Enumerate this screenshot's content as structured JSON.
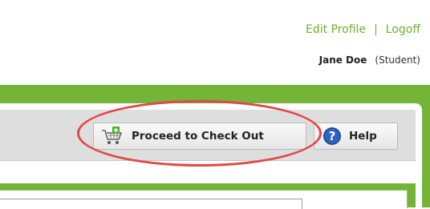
{
  "header": {
    "edit_profile": "Edit Profile",
    "separator": "|",
    "logoff": "Logoff"
  },
  "user": {
    "name": "Jane Doe",
    "role": "(Student)"
  },
  "toolbar": {
    "checkout_label": "Proceed to Check Out",
    "checkout_icon": "cart-add-icon",
    "help_label": "Help",
    "help_icon": "question-circle-icon"
  },
  "colors": {
    "accent_green": "#74b539",
    "link_green": "#6bb22e",
    "highlight_red": "#e04848",
    "help_blue": "#1f4e9c"
  }
}
